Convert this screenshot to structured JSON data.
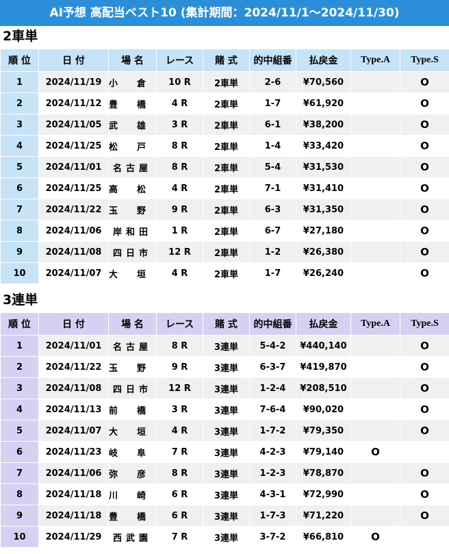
{
  "banner": {
    "title": "AI予想 高配当ベスト10 (集計期間：2024/11/1～2024/11/30)"
  },
  "headers": {
    "rank": "順 位",
    "date": "日 付",
    "venue": "場 名",
    "race": "レース",
    "bet": "賭 式",
    "combo": "的中組番",
    "payout": "払戻金",
    "type_a": "Type.A",
    "type_s": "Type.S"
  },
  "sections": [
    {
      "title": "2車単",
      "rows": [
        {
          "rank": "1",
          "date": "2024/11/19",
          "venue": "小倉",
          "race": "10 R",
          "bet": "2車単",
          "combo": "2-6",
          "payout": "¥70,560",
          "type_a": "",
          "type_s": "O"
        },
        {
          "rank": "2",
          "date": "2024/11/12",
          "venue": "豊橋",
          "race": "4 R",
          "bet": "2車単",
          "combo": "1-7",
          "payout": "¥61,920",
          "type_a": "",
          "type_s": "O"
        },
        {
          "rank": "3",
          "date": "2024/11/05",
          "venue": "武雄",
          "race": "3 R",
          "bet": "2車単",
          "combo": "6-1",
          "payout": "¥38,200",
          "type_a": "",
          "type_s": "O"
        },
        {
          "rank": "4",
          "date": "2024/11/25",
          "venue": "松戸",
          "race": "8 R",
          "bet": "2車単",
          "combo": "1-4",
          "payout": "¥33,420",
          "type_a": "",
          "type_s": "O"
        },
        {
          "rank": "5",
          "date": "2024/11/01",
          "venue": "名古屋",
          "race": "8 R",
          "bet": "2車単",
          "combo": "5-4",
          "payout": "¥31,530",
          "type_a": "",
          "type_s": "O"
        },
        {
          "rank": "6",
          "date": "2024/11/25",
          "venue": "高松",
          "race": "4 R",
          "bet": "2車単",
          "combo": "7-1",
          "payout": "¥31,410",
          "type_a": "",
          "type_s": "O"
        },
        {
          "rank": "7",
          "date": "2024/11/22",
          "venue": "玉野",
          "race": "9 R",
          "bet": "2車単",
          "combo": "6-3",
          "payout": "¥31,350",
          "type_a": "",
          "type_s": "O"
        },
        {
          "rank": "8",
          "date": "2024/11/06",
          "venue": "岸和田",
          "race": "1 R",
          "bet": "2車単",
          "combo": "6-7",
          "payout": "¥27,180",
          "type_a": "",
          "type_s": "O"
        },
        {
          "rank": "9",
          "date": "2024/11/08",
          "venue": "四日市",
          "race": "12 R",
          "bet": "2車単",
          "combo": "1-2",
          "payout": "¥26,380",
          "type_a": "",
          "type_s": "O"
        },
        {
          "rank": "10",
          "date": "2024/11/07",
          "venue": "大垣",
          "race": "4 R",
          "bet": "2車単",
          "combo": "1-7",
          "payout": "¥26,240",
          "type_a": "",
          "type_s": "O"
        }
      ]
    },
    {
      "title": "3連単",
      "rows": [
        {
          "rank": "1",
          "date": "2024/11/01",
          "venue": "名古屋",
          "race": "8 R",
          "bet": "3連単",
          "combo": "5-4-2",
          "payout": "¥440,140",
          "type_a": "",
          "type_s": "O"
        },
        {
          "rank": "2",
          "date": "2024/11/22",
          "venue": "玉野",
          "race": "9 R",
          "bet": "3連単",
          "combo": "6-3-7",
          "payout": "¥419,870",
          "type_a": "",
          "type_s": "O"
        },
        {
          "rank": "3",
          "date": "2024/11/08",
          "venue": "四日市",
          "race": "12 R",
          "bet": "3連単",
          "combo": "1-2-4",
          "payout": "¥208,510",
          "type_a": "",
          "type_s": "O"
        },
        {
          "rank": "4",
          "date": "2024/11/13",
          "venue": "前橋",
          "race": "3 R",
          "bet": "3連単",
          "combo": "7-6-4",
          "payout": "¥90,020",
          "type_a": "",
          "type_s": "O"
        },
        {
          "rank": "5",
          "date": "2024/11/07",
          "venue": "大垣",
          "race": "4 R",
          "bet": "3連単",
          "combo": "1-7-2",
          "payout": "¥79,350",
          "type_a": "",
          "type_s": "O"
        },
        {
          "rank": "6",
          "date": "2024/11/23",
          "venue": "岐阜",
          "race": "7 R",
          "bet": "3連単",
          "combo": "4-2-3",
          "payout": "¥79,140",
          "type_a": "O",
          "type_s": ""
        },
        {
          "rank": "7",
          "date": "2024/11/06",
          "venue": "弥彦",
          "race": "8 R",
          "bet": "3連単",
          "combo": "1-2-3",
          "payout": "¥78,870",
          "type_a": "",
          "type_s": "O"
        },
        {
          "rank": "8",
          "date": "2024/11/18",
          "venue": "川崎",
          "race": "6 R",
          "bet": "3連単",
          "combo": "4-3-1",
          "payout": "¥72,990",
          "type_a": "",
          "type_s": "O"
        },
        {
          "rank": "9",
          "date": "2024/11/18",
          "venue": "豊橋",
          "race": "6 R",
          "bet": "3連単",
          "combo": "1-7-3",
          "payout": "¥71,220",
          "type_a": "",
          "type_s": "O"
        },
        {
          "rank": "10",
          "date": "2024/11/29",
          "venue": "西武園",
          "race": "7 R",
          "bet": "3連単",
          "combo": "3-7-2",
          "payout": "¥66,810",
          "type_a": "O",
          "type_s": ""
        }
      ]
    }
  ],
  "colors": {
    "banner_bg": "#2a8fd8",
    "header_2t": "#c7e3f7",
    "header_3t": "#d4d1f2",
    "stripe": "#f0f0f0"
  }
}
